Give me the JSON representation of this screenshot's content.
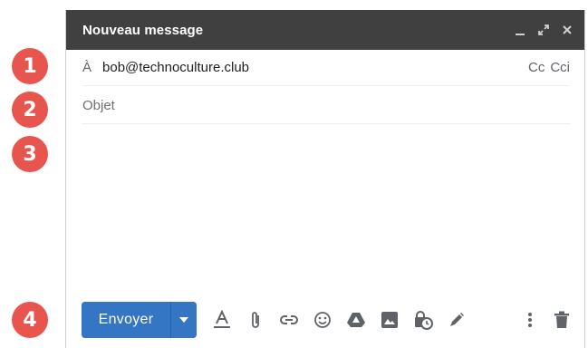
{
  "badges": [
    "1",
    "2",
    "3",
    "4"
  ],
  "compose": {
    "title": "Nouveau message",
    "to_label": "À",
    "to_value": "bob@technoculture.club",
    "cc_label": "Cc",
    "bcc_label": "Cci",
    "subject_placeholder": "Objet",
    "send_label": "Envoyer"
  },
  "icons": {
    "minimize": "minimize-icon",
    "expand": "expand-icon",
    "close": "close-icon",
    "send_options": "caret-down-icon",
    "formatting": "text-format-icon",
    "attach": "paperclip-icon",
    "link": "link-icon",
    "emoji": "emoji-icon",
    "drive": "drive-icon",
    "photo": "photo-icon",
    "confidential": "lock-clock-icon",
    "signature": "pen-icon",
    "more": "more-vert-icon",
    "discard": "trash-icon"
  },
  "colors": {
    "titlebar": "#404040",
    "send_button": "#3576c4",
    "badge": "#e8554e",
    "icon": "#5f6368"
  }
}
